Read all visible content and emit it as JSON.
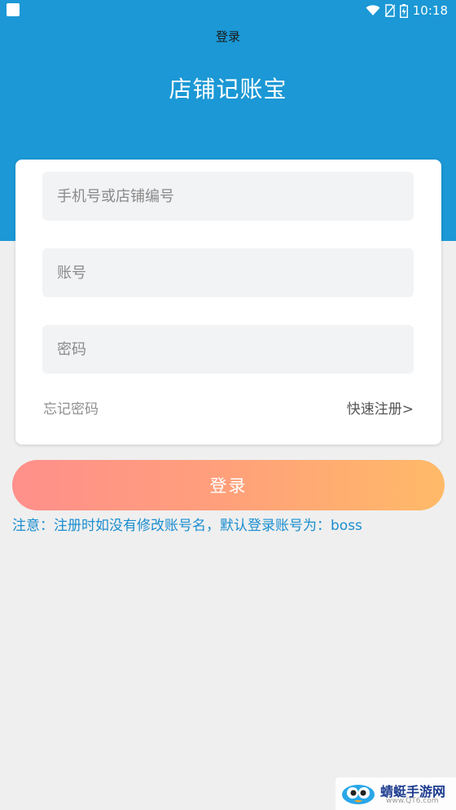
{
  "status_bar": {
    "time": "10:18"
  },
  "nav": {
    "title": "登录"
  },
  "app": {
    "title": "店铺记账宝"
  },
  "form": {
    "store_field": {
      "placeholder": "手机号或店铺编号",
      "value": ""
    },
    "account_field": {
      "placeholder": "账号",
      "value": ""
    },
    "password_field": {
      "placeholder": "密码",
      "value": ""
    },
    "forgot_label": "忘记密码",
    "register_label": "快速注册>"
  },
  "login_button": {
    "label": "登录"
  },
  "notice": "注意：注册时如没有修改账号名，默认登录账号为：boss",
  "watermark": {
    "name": "蜻蜓手游网",
    "url": "www.QT6.com"
  },
  "colors": {
    "header": "#1b98d5",
    "background": "#efefef",
    "notice_text": "#1b8ed0",
    "button_gradient_start": "#ff8f8b",
    "button_gradient_end": "#ffba68"
  }
}
